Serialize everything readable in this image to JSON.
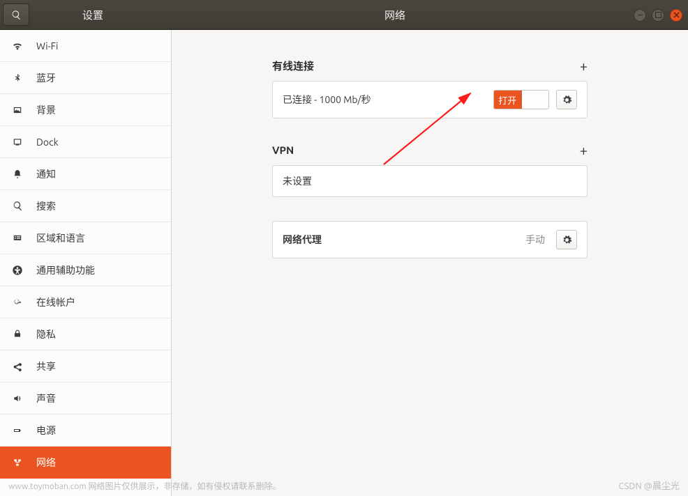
{
  "titlebar": {
    "left_title": "设置",
    "center_title": "网络"
  },
  "sidebar": {
    "items": [
      {
        "icon": "wifi-icon",
        "label": "Wi-Fi"
      },
      {
        "icon": "bluetooth-icon",
        "label": "蓝牙"
      },
      {
        "icon": "background-icon",
        "label": "背景"
      },
      {
        "icon": "dock-icon",
        "label": "Dock"
      },
      {
        "icon": "notification-icon",
        "label": "通知"
      },
      {
        "icon": "search-icon",
        "label": "搜索"
      },
      {
        "icon": "region-icon",
        "label": "区域和语言"
      },
      {
        "icon": "accessibility-icon",
        "label": "通用辅助功能"
      },
      {
        "icon": "online-accounts-icon",
        "label": "在线帐户"
      },
      {
        "icon": "privacy-icon",
        "label": "隐私"
      },
      {
        "icon": "sharing-icon",
        "label": "共享"
      },
      {
        "icon": "sound-icon",
        "label": "声音"
      },
      {
        "icon": "power-icon",
        "label": "电源"
      },
      {
        "icon": "network-icon",
        "label": "网络",
        "active": true
      }
    ]
  },
  "sections": {
    "wired": {
      "header": "有线连接",
      "status": "已连接 - 1000 Mb/秒",
      "switch_on_label": "打开"
    },
    "vpn": {
      "header": "VPN",
      "status": "未设置"
    },
    "proxy": {
      "header": "网络代理",
      "value": "手动"
    }
  },
  "watermarks": {
    "left": "www.toymoban.com 网络图片仅供展示，非存储，如有侵权请联系删除。",
    "right": "CSDN @晨尘光"
  }
}
